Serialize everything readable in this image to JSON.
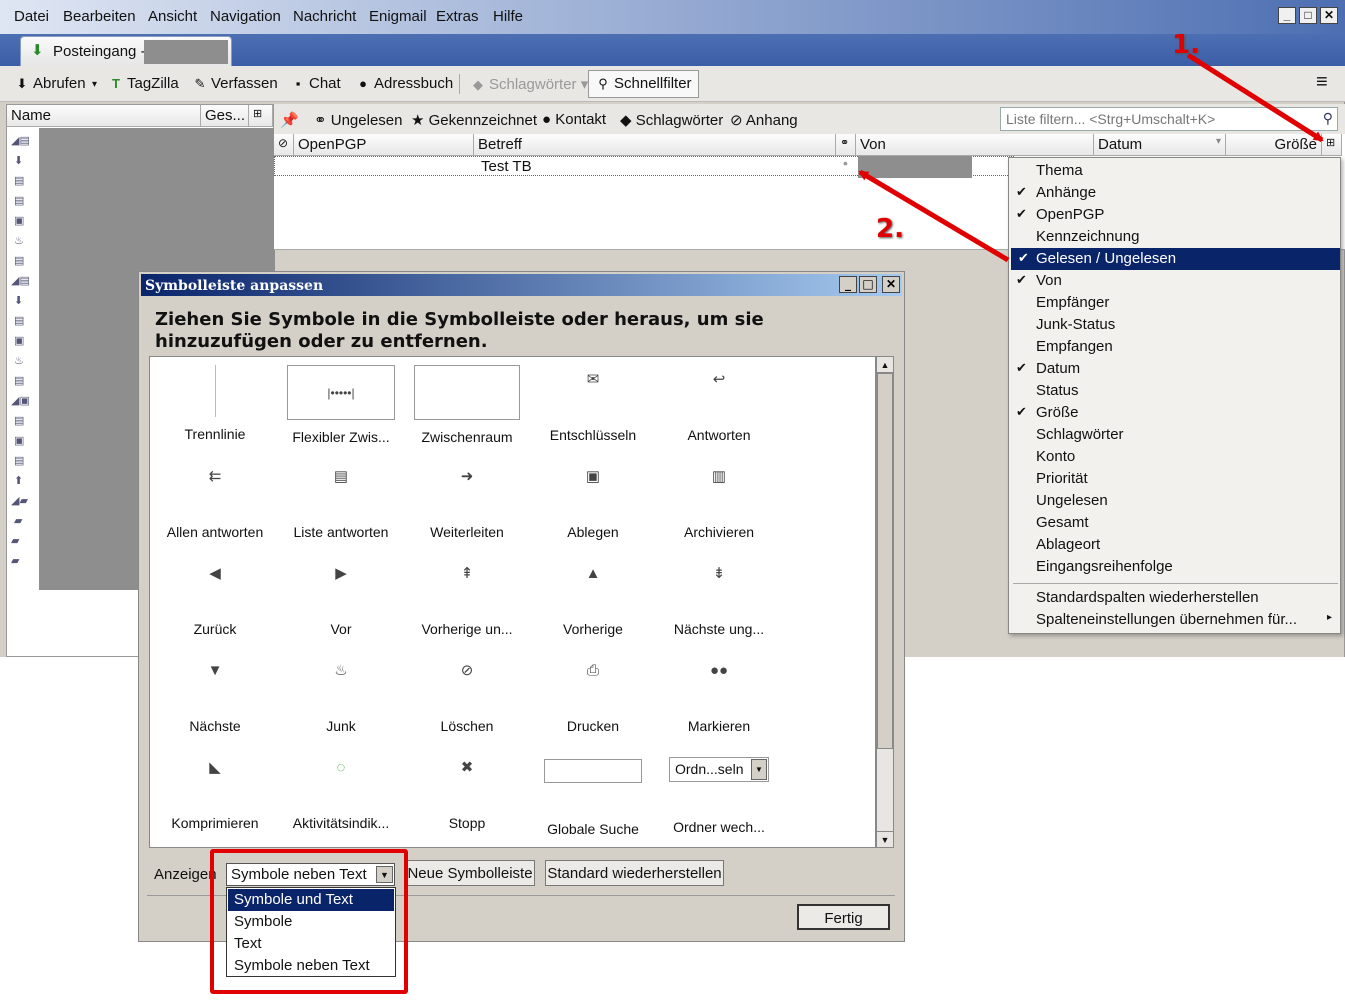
{
  "menubar": [
    "Datei",
    "Bearbeiten",
    "Ansicht",
    "Navigation",
    "Nachricht",
    "Enigmail",
    "Extras",
    "Hilfe"
  ],
  "window_buttons": [
    "_",
    "□",
    "✕"
  ],
  "tab": {
    "label": "Posteingang -"
  },
  "toolbar": {
    "abrufen": "Abrufen",
    "tagzilla": "TagZilla",
    "verfassen": "Verfassen",
    "chat": "Chat",
    "adressbuch": "Adressbuch",
    "schlagwoerter": "Schlagwörter",
    "schnellfilter": "Schnellfilter"
  },
  "folderpane": {
    "col_name": "Name",
    "col_ges": "Ges..."
  },
  "quickfilter": {
    "ungelesen": "Ungelesen",
    "gekennzeichnet": "Gekennzeichnet",
    "kontakt": "Kontakt",
    "schlagwoerter": "Schlagwörter",
    "anhang": "Anhang",
    "placeholder": "Liste filtern... <Strg+Umschalt+K>"
  },
  "columns": {
    "openpgp": "OpenPGP",
    "betreff": "Betreff",
    "von": "Von",
    "datum": "Datum",
    "groesse": "Größe"
  },
  "message": {
    "subject": "Test TB"
  },
  "column_menu": {
    "items": [
      {
        "label": "Thema",
        "checked": false
      },
      {
        "label": "Anhänge",
        "checked": true
      },
      {
        "label": "OpenPGP",
        "checked": true
      },
      {
        "label": "Kennzeichnung",
        "checked": false
      },
      {
        "label": "Gelesen / Ungelesen",
        "checked": true,
        "selected": true
      },
      {
        "label": "Von",
        "checked": true
      },
      {
        "label": "Empfänger",
        "checked": false
      },
      {
        "label": "Junk-Status",
        "checked": false
      },
      {
        "label": "Empfangen",
        "checked": false
      },
      {
        "label": "Datum",
        "checked": true
      },
      {
        "label": "Status",
        "checked": false
      },
      {
        "label": "Größe",
        "checked": true
      },
      {
        "label": "Schlagwörter",
        "checked": false
      },
      {
        "label": "Konto",
        "checked": false
      },
      {
        "label": "Priorität",
        "checked": false
      },
      {
        "label": "Ungelesen",
        "checked": false
      },
      {
        "label": "Gesamt",
        "checked": false
      },
      {
        "label": "Ablageort",
        "checked": false
      },
      {
        "label": "Eingangsreihenfolge",
        "checked": false
      }
    ],
    "restore": "Standardspalten wiederherstellen",
    "apply": "Spalteneinstellungen übernehmen für..."
  },
  "annotations": {
    "one": "1.",
    "two": "2.",
    "color": "#e00000"
  },
  "dialog": {
    "title": "Symbolleiste anpassen",
    "heading": "Ziehen Sie Symbole in die Symbolleiste oder heraus, um sie hinzuzufügen oder zu entfernen.",
    "palette": [
      {
        "label": "Trennlinie",
        "icon": "separator"
      },
      {
        "label": "Flexibler Zwis...",
        "icon": "flex-space"
      },
      {
        "label": "Zwischenraum",
        "icon": "space"
      },
      {
        "label": "Entschlüsseln",
        "icon": "decrypt-icon"
      },
      {
        "label": "Antworten",
        "icon": "reply-icon"
      },
      {
        "label": "Allen antworten",
        "icon": "reply-all-icon"
      },
      {
        "label": "Liste antworten",
        "icon": "reply-list-icon"
      },
      {
        "label": "Weiterleiten",
        "icon": "forward-icon"
      },
      {
        "label": "Ablegen",
        "icon": "file-icon"
      },
      {
        "label": "Archivieren",
        "icon": "archive-icon"
      },
      {
        "label": "Zurück",
        "icon": "back-icon"
      },
      {
        "label": "Vor",
        "icon": "forward-nav-icon"
      },
      {
        "label": "Vorherige un...",
        "icon": "prev-unread-icon"
      },
      {
        "label": "Vorherige",
        "icon": "prev-icon"
      },
      {
        "label": "Nächste ung...",
        "icon": "next-unread-icon"
      },
      {
        "label": "Nächste",
        "icon": "next-icon"
      },
      {
        "label": "Junk",
        "icon": "junk-icon"
      },
      {
        "label": "Löschen",
        "icon": "delete-icon"
      },
      {
        "label": "Drucken",
        "icon": "print-icon"
      },
      {
        "label": "Markieren",
        "icon": "mark-icon"
      },
      {
        "label": "Komprimieren",
        "icon": "compact-icon"
      },
      {
        "label": "Aktivitätsindik...",
        "icon": "throbber-icon"
      },
      {
        "label": "Stopp",
        "icon": "stop-icon"
      },
      {
        "label": "Globale Suche",
        "icon": "search-box"
      },
      {
        "label": "Ordner wech...",
        "icon": "folder-select"
      }
    ],
    "folder_select_value": "Ordn...seln",
    "anzeigen_label": "Anzeigen",
    "anzeigen_value": "Symbole neben Text",
    "anzeigen_options": [
      "Symbole und Text",
      "Symbole",
      "Text",
      "Symbole neben Text"
    ],
    "neue_symbolleiste": "Neue Symbolleiste",
    "standard": "Standard wiederherstellen",
    "fertig": "Fertig"
  }
}
